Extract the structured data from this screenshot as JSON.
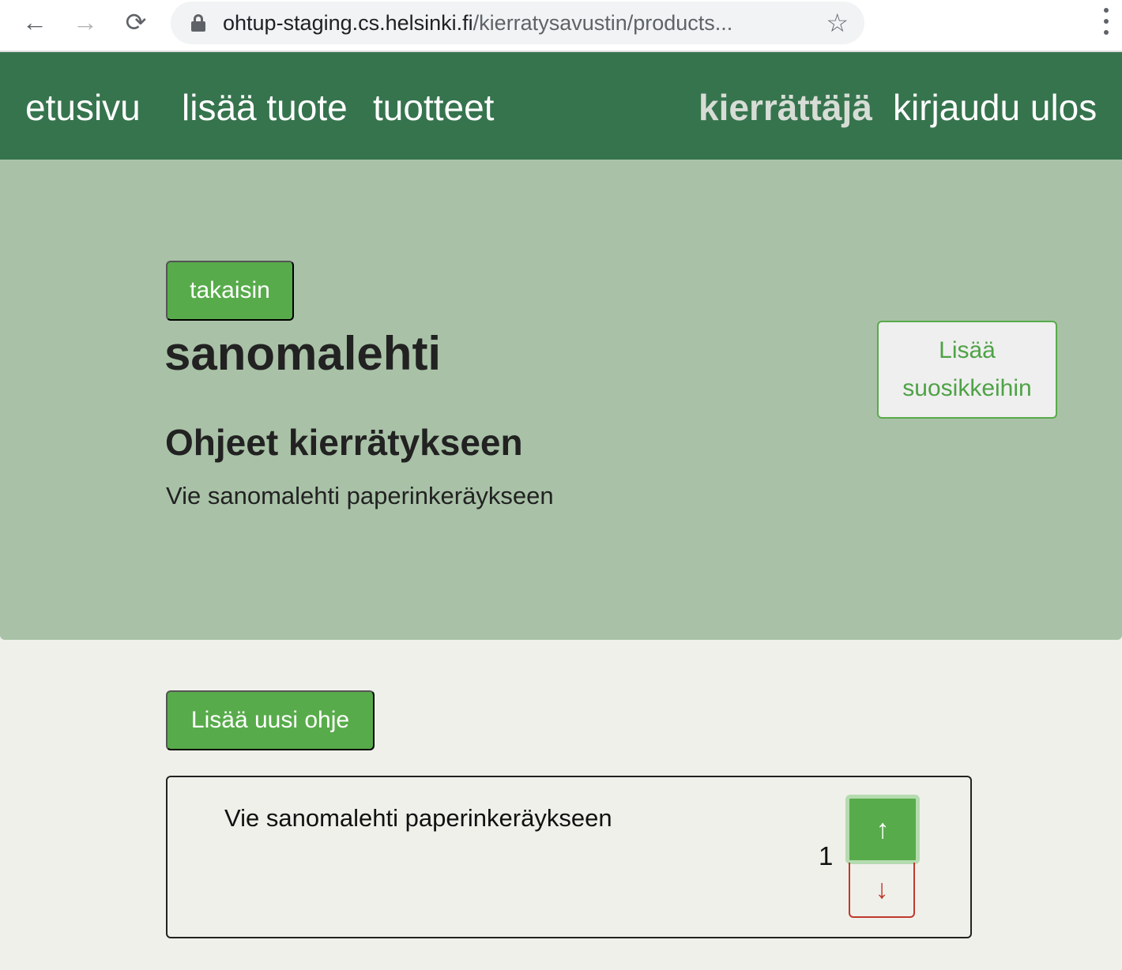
{
  "browser": {
    "url_domain": "ohtup-staging.cs.helsinki.fi",
    "url_path": "/kierratysavustin/products...",
    "icons": {
      "back": "arrow-left-icon",
      "forward": "arrow-right-icon",
      "reload": "reload-icon",
      "lock": "lock-icon",
      "bookmark": "star-icon",
      "menu": "kebab-menu-icon"
    }
  },
  "navbar": {
    "home": "etusivu",
    "add_product": "lisää tuote",
    "products": "tuotteet",
    "user": "kierrättäjä",
    "logout": "kirjaudu ulos"
  },
  "product": {
    "back_label": "takaisin",
    "name": "sanomalehti",
    "favorite_label": "Lisää suosikkeihin",
    "instructions_heading": "Ohjeet kierrätykseen",
    "instruction_text": "Vie sanomalehti paperinkeräykseen"
  },
  "instructions": {
    "add_label": "Lisää uusi ohje",
    "items": [
      {
        "text": "Vie sanomalehti paperinkeräykseen",
        "score": "1",
        "up_icon": "↑",
        "down_icon": "↓"
      }
    ]
  },
  "colors": {
    "navbar": "#36744e",
    "hero": "#a9c2a7",
    "primary_button": "#58ab4b",
    "danger": "#c0392b",
    "page_background": "#f0f0eb"
  }
}
